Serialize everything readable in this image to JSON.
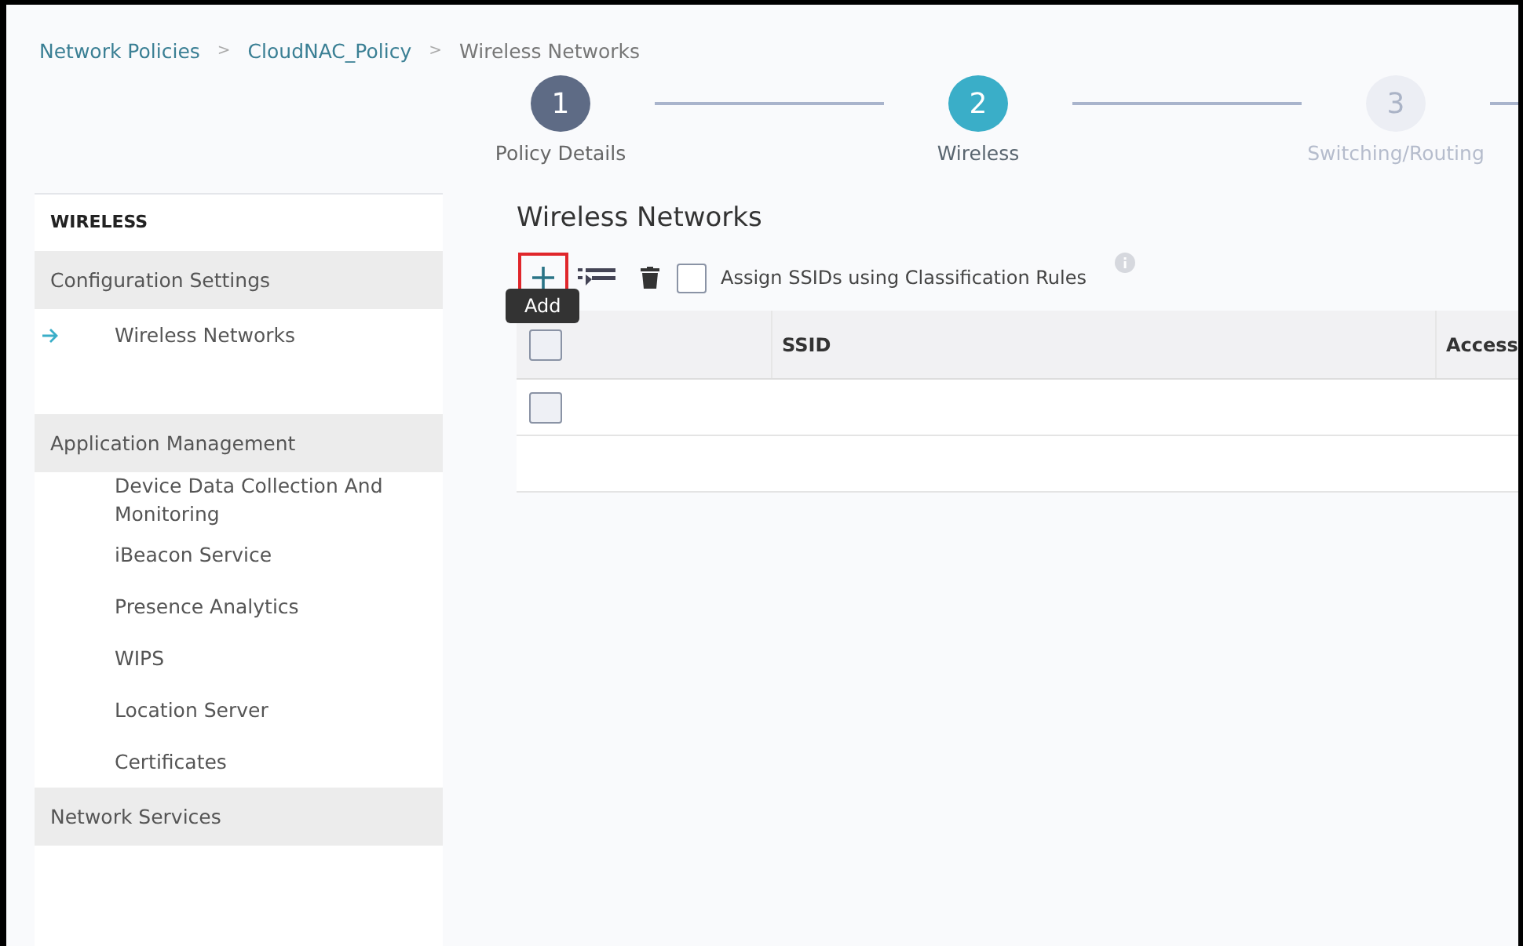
{
  "breadcrumb": [
    {
      "label": "Network Policies",
      "kind": "link",
      "separator": ">"
    },
    {
      "label": "CloudNAC_Policy",
      "kind": "link",
      "separator": ">"
    },
    {
      "label": "Wireless Networks",
      "kind": "current"
    }
  ],
  "steps": [
    {
      "number": "1",
      "label": "Policy Details",
      "completed": true,
      "selected": false
    },
    {
      "number": "2",
      "label": "Wireless",
      "completed": false,
      "selected": true
    },
    {
      "number": "3",
      "label": "Switching/Routing",
      "completed": false,
      "selected": false
    }
  ],
  "sidebar": {
    "title": "WIRELESS",
    "sections": [
      {
        "label": "Configuration Settings",
        "items": [
          {
            "label": "Wireless Networks",
            "selected": true
          }
        ]
      },
      {
        "label": "Application Management",
        "items": [
          {
            "label": "Device Data Collection And Monitoring",
            "selected": false
          },
          {
            "label": "iBeacon Service",
            "selected": false
          },
          {
            "label": "Presence Analytics",
            "selected": false
          },
          {
            "label": "WIPS",
            "selected": false
          },
          {
            "label": "Location Server",
            "selected": false
          },
          {
            "label": "Certificates",
            "selected": false
          }
        ]
      },
      {
        "label": "Network Services"
      }
    ]
  },
  "main": {
    "title": "Wireless Networks",
    "add_tooltip": "Add",
    "assign_checkbox": {
      "label": "Assign SSIDs using Classification Rules",
      "checked": false
    },
    "table": {
      "header_checked": false,
      "columns": [
        "SSID",
        "Access"
      ],
      "rows": [
        {
          "checked": false
        }
      ]
    }
  }
}
